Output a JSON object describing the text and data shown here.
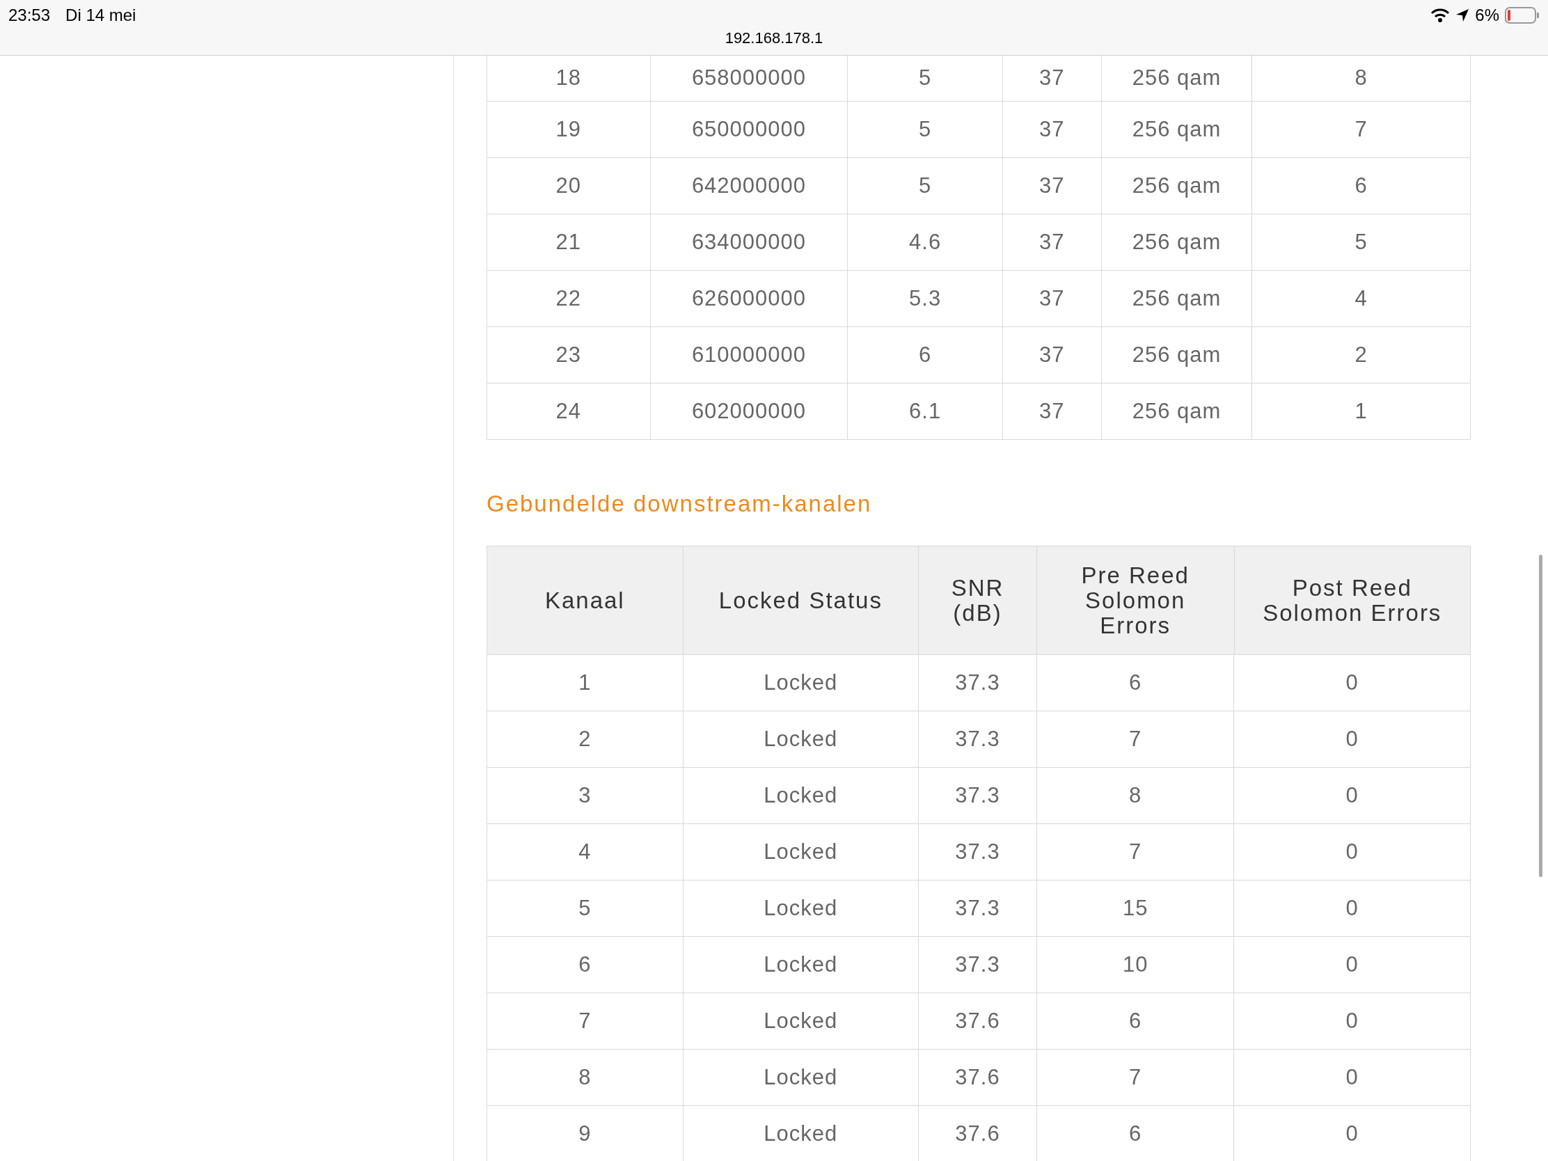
{
  "status_bar": {
    "time": "23:53",
    "date": "Di 14 mei",
    "url": "192.168.178.1",
    "battery_text": "6%"
  },
  "upper_table": {
    "rows": [
      [
        "18",
        "658000000",
        "5",
        "37",
        "256 qam",
        "8"
      ],
      [
        "19",
        "650000000",
        "5",
        "37",
        "256 qam",
        "7"
      ],
      [
        "20",
        "642000000",
        "5",
        "37",
        "256 qam",
        "6"
      ],
      [
        "21",
        "634000000",
        "4.6",
        "37",
        "256 qam",
        "5"
      ],
      [
        "22",
        "626000000",
        "5.3",
        "37",
        "256 qam",
        "4"
      ],
      [
        "23",
        "610000000",
        "6",
        "37",
        "256 qam",
        "2"
      ],
      [
        "24",
        "602000000",
        "6.1",
        "37",
        "256 qam",
        "1"
      ]
    ]
  },
  "section_title": "Gebundelde downstream-kanalen",
  "bonded_table": {
    "columns": [
      "Kanaal",
      "Locked Status",
      "SNR (dB)",
      "Pre Reed Solomon Errors",
      "Post Reed Solomon Errors"
    ],
    "rows": [
      [
        "1",
        "Locked",
        "37.3",
        "6",
        "0"
      ],
      [
        "2",
        "Locked",
        "37.3",
        "7",
        "0"
      ],
      [
        "3",
        "Locked",
        "37.3",
        "8",
        "0"
      ],
      [
        "4",
        "Locked",
        "37.3",
        "7",
        "0"
      ],
      [
        "5",
        "Locked",
        "37.3",
        "15",
        "0"
      ],
      [
        "6",
        "Locked",
        "37.3",
        "10",
        "0"
      ],
      [
        "7",
        "Locked",
        "37.6",
        "6",
        "0"
      ],
      [
        "8",
        "Locked",
        "37.6",
        "7",
        "0"
      ],
      [
        "9",
        "Locked",
        "37.6",
        "6",
        "0"
      ]
    ]
  }
}
